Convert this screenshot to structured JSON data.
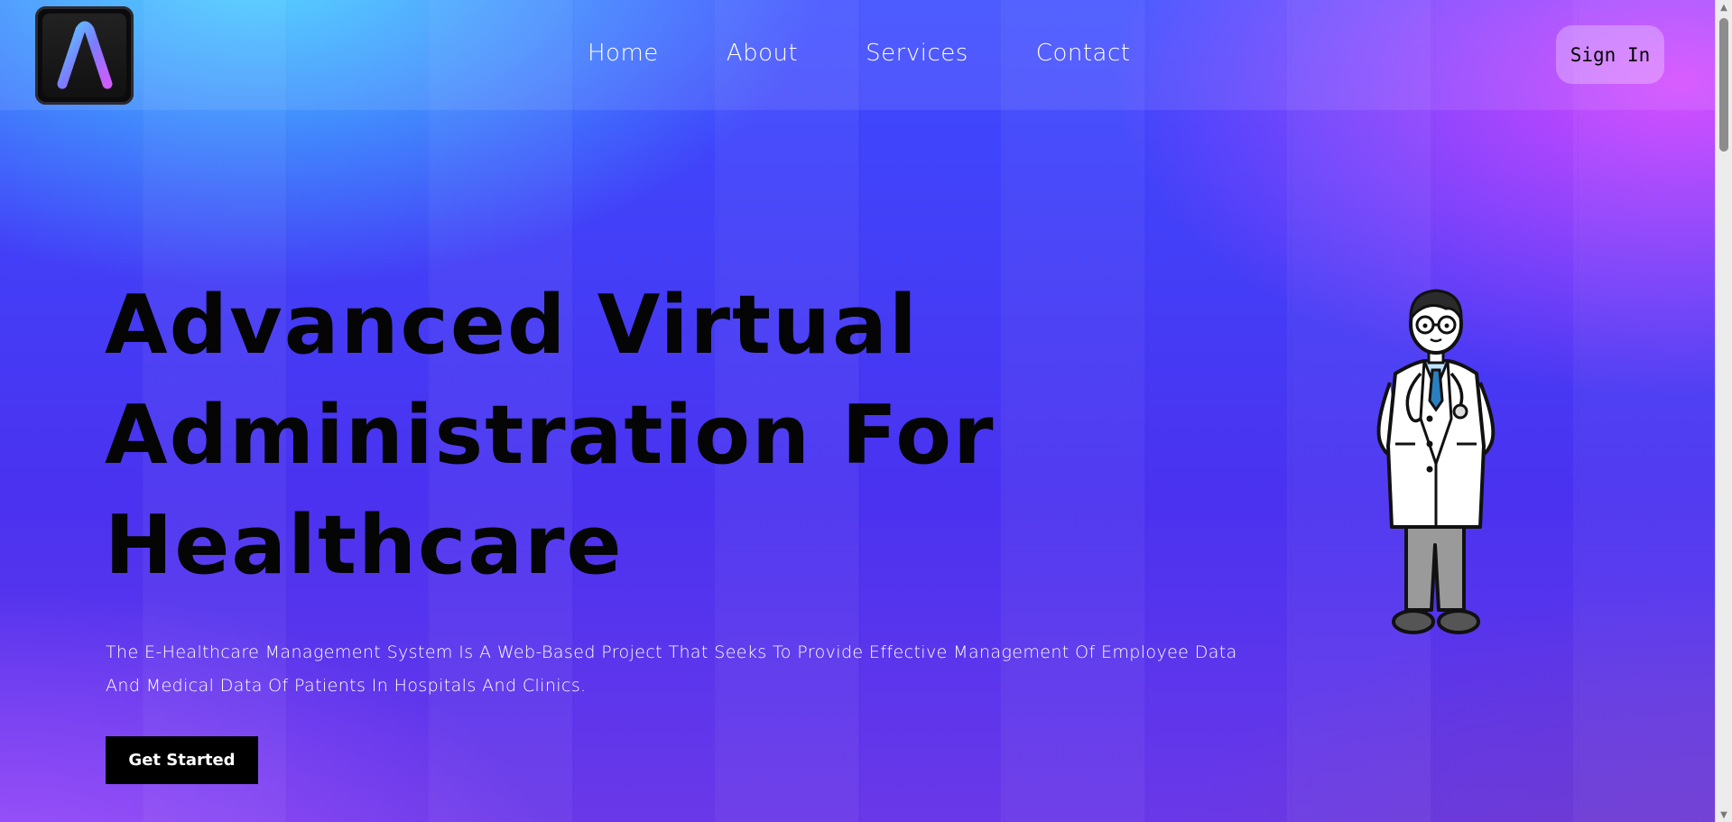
{
  "brand": {
    "logo_letter": "A",
    "logo_icon": "letter-a-logo-icon"
  },
  "nav": {
    "items": [
      {
        "label": "Home"
      },
      {
        "label": "About"
      },
      {
        "label": "Services"
      },
      {
        "label": "Contact"
      }
    ]
  },
  "header": {
    "signin_label": "Sign In"
  },
  "hero": {
    "title_lines": [
      "Advanced Virtual",
      "Administration For",
      "Healthcare"
    ],
    "description": "The E-Healthcare Management System Is A Web-Based Project That Seeks To Provide Effective Management Of Employee Data And Medical Data Of Patients In Hospitals And Clinics.",
    "cta_label": "Get Started",
    "illustration_icon": "doctor-illustration-icon"
  },
  "colors": {
    "gradient_top_left": "#46dcff",
    "gradient_center": "#3c3cff",
    "gradient_top_right": "#dc46ff",
    "title_text": "#050505",
    "cta_background": "#000000"
  }
}
